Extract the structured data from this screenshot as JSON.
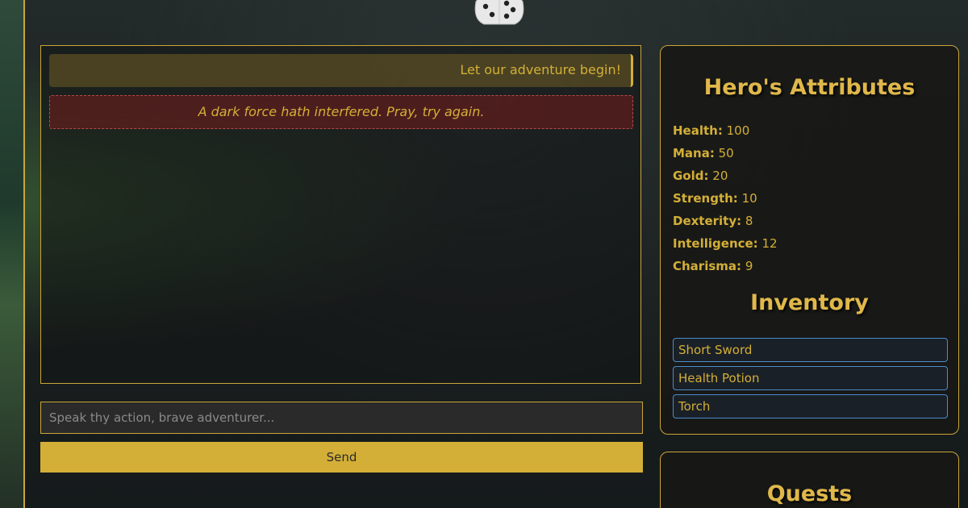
{
  "chat": {
    "messages": [
      {
        "type": "system",
        "text": "Let our adventure begin!"
      },
      {
        "type": "error",
        "text": "A dark force hath interfered. Pray, try again."
      }
    ]
  },
  "input": {
    "placeholder": "Speak thy action, brave adventurer...",
    "value": ""
  },
  "send_label": "Send",
  "attributes": {
    "title": "Hero's Attributes",
    "items": [
      {
        "label": "Health:",
        "value": "100"
      },
      {
        "label": "Mana:",
        "value": "50"
      },
      {
        "label": "Gold:",
        "value": "20"
      },
      {
        "label": "Strength:",
        "value": "10"
      },
      {
        "label": "Dexterity:",
        "value": "8"
      },
      {
        "label": "Intelligence:",
        "value": "12"
      },
      {
        "label": "Charisma:",
        "value": "9"
      }
    ]
  },
  "inventory": {
    "title": "Inventory",
    "items": [
      "Short Sword",
      "Health Potion",
      "Torch"
    ]
  },
  "quests": {
    "title": "Quests"
  },
  "colors": {
    "accent": "#d4af37",
    "error_bg": "#6e1c1c",
    "inventory_border": "#4b8ccc"
  },
  "icons": {
    "dice": "dice-icon"
  }
}
